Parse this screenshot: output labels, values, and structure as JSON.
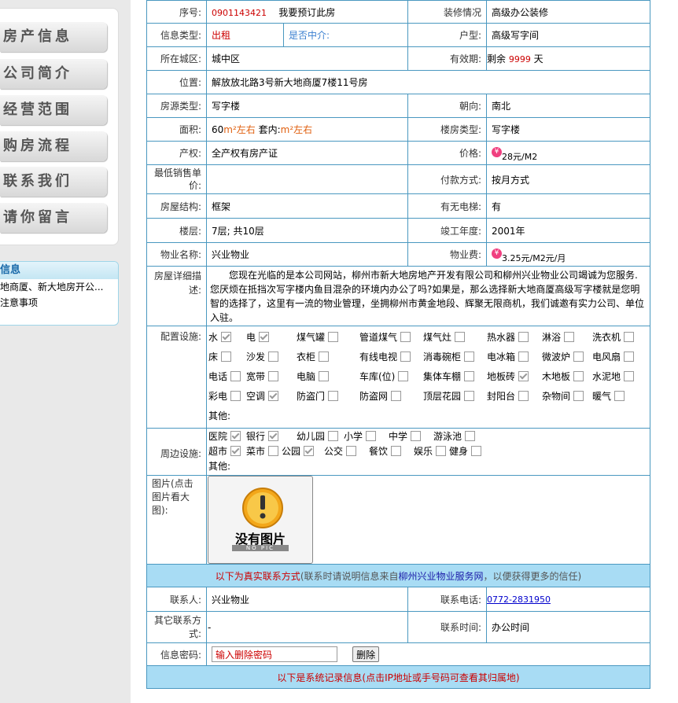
{
  "sidebar": {
    "menu": [
      "房产信息",
      "公司简介",
      "经营范围",
      "购房流程",
      "联系我们",
      "请你留言"
    ],
    "info_title": "信息",
    "info_items": [
      "地商厦、新大地房开公...",
      "注意事项"
    ]
  },
  "detail": {
    "serial_label": "序号:",
    "serial_value": "0901143421",
    "reserve_text": "我要预订此房",
    "decor_label": "装修情况",
    "decor_value": "高级办公装修",
    "info_type_label": "信息类型:",
    "info_type_value": "出租",
    "agent_label": "是否中介:",
    "layout_label": "户型:",
    "layout_value": "高级写字间",
    "district_label": "所在城区:",
    "district_value": "城中区",
    "validity_label": "有效期:",
    "validity_prefix": "剩余",
    "validity_days": "9999",
    "validity_suffix": "天",
    "location_label": "位置:",
    "location_value": "解放放北路3号新大地商厦7楼11号房",
    "source_label": "房源类型:",
    "source_value": "写字楼",
    "orient_label": "朝向:",
    "orient_value": "南北",
    "area_label": "面积:",
    "area_num": "60",
    "area_unit": "m²左右",
    "inner_label": "套内:",
    "inner_unit": "m²左右",
    "building_type_label": "楼房类型:",
    "building_type_value": "写字楼",
    "property_label": "产权:",
    "property_value": "全产权有房产证",
    "price_label": "价格:",
    "price_value": "28元/M2",
    "min_price_label": "最低销售单价:",
    "min_price_value": "",
    "payment_label": "付款方式:",
    "payment_value": "按月方式",
    "structure_label": "房屋结构:",
    "structure_value": "框架",
    "elevator_label": "有无电梯:",
    "elevator_value": "有",
    "floor_label": "楼层:",
    "floor_value": "7层;  共10层",
    "completion_label": "竣工年度:",
    "completion_value": "2001年",
    "mgmt_label": "物业名称:",
    "mgmt_value": "兴业物业",
    "mgmt_fee_label": "物业费:",
    "mgmt_fee_value": "3.25元/M2元/月",
    "desc_label": "房屋详细描述:",
    "desc_text": "您现在光临的是本公司网站，柳州市新大地房地产开发有限公司和柳州兴业物业公司竭诚为您服务.您厌烦在抵挡次写字楼内鱼目混杂的环境内办公了吗?如果是，那么选择新大地商厦高级写字楼就是您明智的选择了，这里有一流的物业管理，坐拥柳州市黄金地段、辉聚无限商机，我们诚邀有实力公司、单位入驻。",
    "config_label": "配置设施:",
    "config_items": [
      {
        "name": "水",
        "checked": true
      },
      {
        "name": "电",
        "checked": true
      },
      {
        "name": "煤气罐",
        "checked": false
      },
      {
        "name": "管道煤气",
        "checked": false
      },
      {
        "name": "煤气灶",
        "checked": false
      },
      {
        "name": "热水器",
        "checked": false
      },
      {
        "name": "淋浴",
        "checked": false
      },
      {
        "name": "洗衣机",
        "checked": false
      },
      {
        "name": "床",
        "checked": false
      },
      {
        "name": "沙发",
        "checked": false
      },
      {
        "name": "衣柜",
        "checked": false
      },
      {
        "name": "有线电视",
        "checked": false
      },
      {
        "name": "消毒碗柜",
        "checked": false
      },
      {
        "name": "电冰箱",
        "checked": false
      },
      {
        "name": "微波炉",
        "checked": false
      },
      {
        "name": "电风扇",
        "checked": false
      },
      {
        "name": "电话",
        "checked": false
      },
      {
        "name": "宽带",
        "checked": false
      },
      {
        "name": "电脑",
        "checked": false
      },
      {
        "name": "车库(位)",
        "checked": false
      },
      {
        "name": "集体车棚",
        "checked": false
      },
      {
        "name": "地板砖",
        "checked": true
      },
      {
        "name": "木地板",
        "checked": false
      },
      {
        "name": "水泥地",
        "checked": false
      },
      {
        "name": "彩电",
        "checked": false
      },
      {
        "name": "空调",
        "checked": true
      },
      {
        "name": "防盗门",
        "checked": false
      },
      {
        "name": "防盗网",
        "checked": false
      },
      {
        "name": "顶层花园",
        "checked": false
      },
      {
        "name": "封阳台",
        "checked": false
      },
      {
        "name": "杂物间",
        "checked": false
      },
      {
        "name": "暖气",
        "checked": false
      }
    ],
    "config_other": "其他:",
    "around_label": "周边设施:",
    "around_items_row1": [
      {
        "name": "医院",
        "checked": true
      },
      {
        "name": "银行",
        "checked": true
      },
      {
        "name": "幼儿园",
        "checked": false
      },
      {
        "name": "小学",
        "checked": false
      },
      {
        "name": "中学",
        "checked": false
      },
      {
        "name": "游泳池",
        "checked": false
      }
    ],
    "around_items_row2": [
      {
        "name": "超市",
        "checked": true
      },
      {
        "name": "菜市",
        "checked": false
      },
      {
        "name": "公园",
        "checked": true
      },
      {
        "name": "公交",
        "checked": false
      },
      {
        "name": "餐饮",
        "checked": false
      },
      {
        "name": "娱乐",
        "checked": false
      },
      {
        "name": "健身",
        "checked": false
      }
    ],
    "around_other": "其他:",
    "photo_label": "图片(点击图片看大图):",
    "noimg_text": "没有图片",
    "noimg_sub": "NO PIC",
    "contact_bar_pre": "以下为真实联系方式",
    "contact_bar_mid": "(联系时请说明信息来自",
    "contact_bar_site": "柳州兴业物业服务网",
    "contact_bar_post": "，以便获得更多的信任)",
    "contact_label": "联系人:",
    "contact_value": "兴业物业",
    "phone_label": "联系电话:",
    "phone_value": "0772-2831950",
    "other_contact_label": "其它联系方式:",
    "other_contact_value": "-",
    "time_label": "联系时间:",
    "time_value": "办公时间",
    "pwd_label": "信息密码:",
    "pwd_value": "输入删除密码",
    "delete_label": "删除",
    "system_bar": "以下是系统记录信息(点击IP地址或手号码可查看其归属地)"
  }
}
